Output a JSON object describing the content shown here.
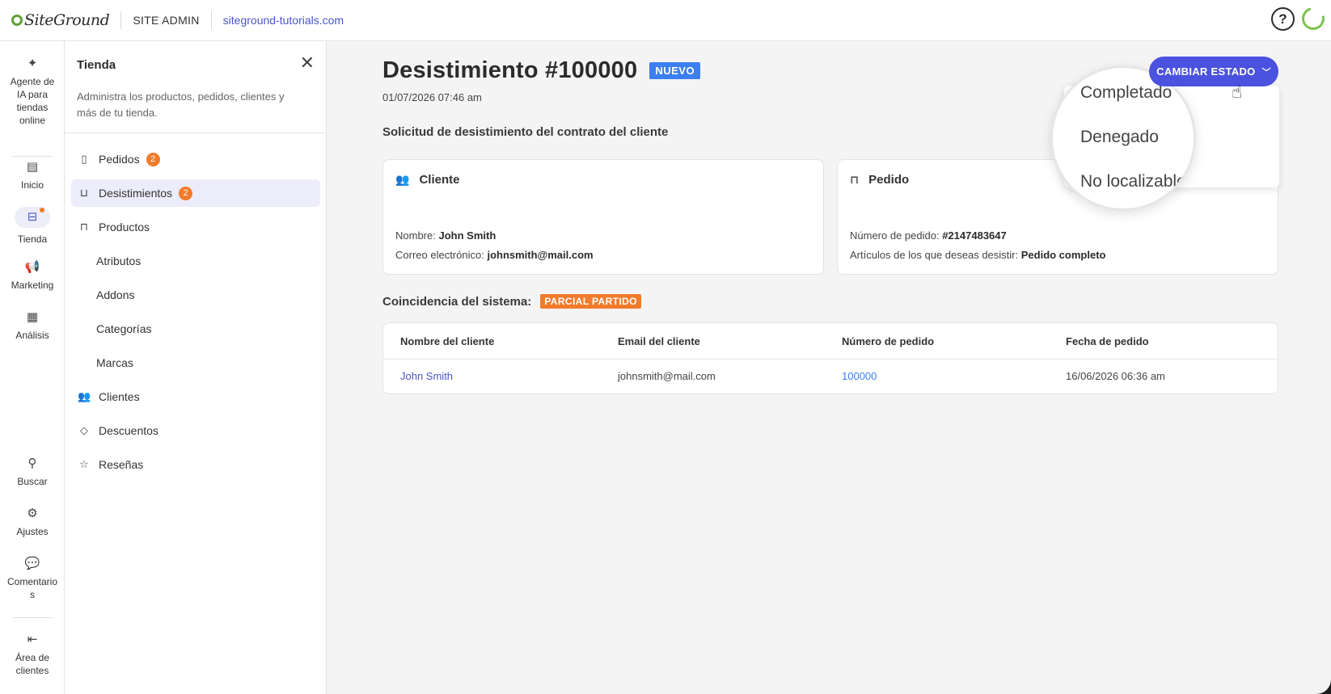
{
  "topbar": {
    "brand": "SiteGround",
    "section": "SITE ADMIN",
    "domain": "siteground-tutorials.com",
    "help_label": "?"
  },
  "rail": {
    "items": [
      {
        "label": "Agente de IA para tiendas online",
        "icon": "sparkle-icon"
      },
      {
        "label": "Inicio",
        "icon": "dashboard-icon"
      },
      {
        "label": "Tienda",
        "icon": "store-icon"
      },
      {
        "label": "Marketing",
        "icon": "megaphone-icon"
      },
      {
        "label": "Análisis",
        "icon": "chart-icon"
      },
      {
        "label": "Buscar",
        "icon": "search-icon"
      },
      {
        "label": "Ajustes",
        "icon": "gear-icon"
      },
      {
        "label": "Comentarios",
        "icon": "feedback-icon"
      },
      {
        "label": "Área de clientes",
        "icon": "exit-icon"
      }
    ]
  },
  "panel": {
    "title": "Tienda",
    "description": "Administra los productos, pedidos, clientes y más de tu tienda.",
    "nav": [
      {
        "label": "Pedidos",
        "badge": "2"
      },
      {
        "label": "Desistimientos",
        "badge": "2"
      },
      {
        "label": "Productos"
      },
      {
        "label": "Atributos"
      },
      {
        "label": "Addons"
      },
      {
        "label": "Categorías"
      },
      {
        "label": "Marcas"
      },
      {
        "label": "Clientes"
      },
      {
        "label": "Descuentos"
      },
      {
        "label": "Reseñas"
      }
    ]
  },
  "main": {
    "title": "Desistimiento #100000",
    "status": "NUEVO",
    "date": "01/07/2026 07:46 am",
    "section_title": "Solicitud de desistimiento del contrato del cliente",
    "change_state_label": "CAMBIAR ESTADO",
    "state_options": [
      "Completado",
      "Denegado",
      "No localizable"
    ],
    "client_card": {
      "title": "Cliente",
      "name_label": "Nombre:",
      "name": "John Smith",
      "email_label": "Correo electrónico:",
      "email": "johnsmith@mail.com"
    },
    "order_card": {
      "title": "Pedido",
      "order_label": "Número de pedido:",
      "order_number": "#2147483647",
      "items_label": "Artículos de los que deseas desistir:",
      "items_value": "Pedido completo"
    },
    "match": {
      "label": "Coincidencia del sistema:",
      "badge": "PARCIAL PARTIDO"
    },
    "table": {
      "headers": [
        "Nombre del cliente",
        "Email del cliente",
        "Número de pedido",
        "Fecha de pedido"
      ],
      "rows": [
        [
          "John Smith",
          "johnsmith@mail.com",
          "100000",
          "16/06/2026 06:36 am"
        ]
      ]
    }
  },
  "colors": {
    "accent": "#4b52e0",
    "status_new": "#3c7ff0",
    "badge_orange": "#f17b2b",
    "brand_green": "#5fa13a"
  }
}
